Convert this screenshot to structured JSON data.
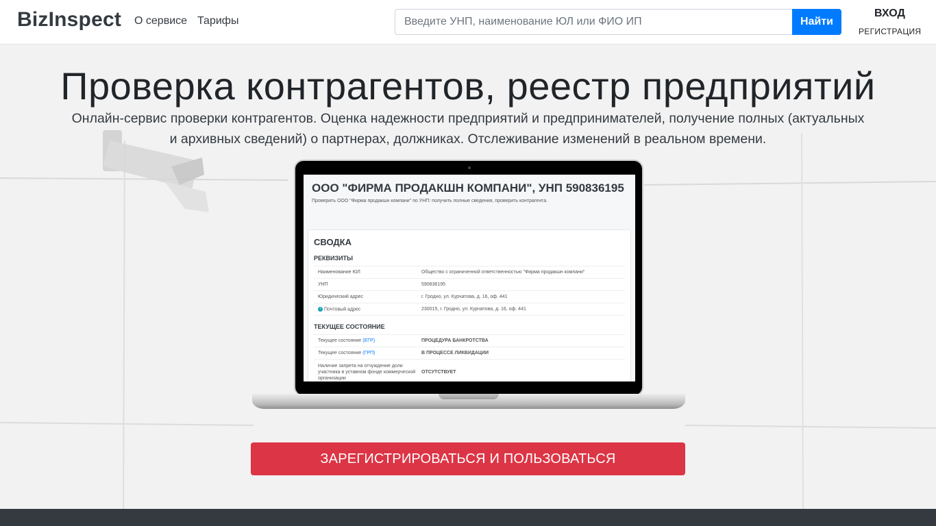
{
  "nav": {
    "brand": "BizInspect",
    "about": "О сервисе",
    "tariffs": "Тарифы",
    "search_placeholder": "Введите УНП, наименование ЮЛ или ФИО ИП",
    "search_button": "Найти",
    "login": "ВХОД",
    "register": "РЕГИСТРАЦИЯ"
  },
  "hero": {
    "title": "Проверка контрагентов, реестр предприятий",
    "lead": "Онлайн-сервис проверки контрагентов. Оценка надежности предприятий и предпринимателей, получение полных (актуальных и архивных сведений) о партнерах, должниках. Отслеживание изменений в реальном времени."
  },
  "screen": {
    "title": "ООО \"ФИРМА ПРОДАКШН КОМПАНИ\", УНП 590836195",
    "subtitle": "Проверить ООО \"Фирма продакшн компани\" по УНП: получить полные сведения, проверить контрагента.",
    "summary_heading": "СВОДКА",
    "requisites_heading": "РЕКВИЗИТЫ",
    "requisites": [
      {
        "key": "Наименование ЮЛ",
        "value": "Общество с ограниченной ответственностью \"Фирма продакшн компани\""
      },
      {
        "key": "УНП",
        "value": "590836195"
      },
      {
        "key": "Юридический адрес",
        "value": "г. Гродно, ул. Курчатова, д. 16, оф. 441"
      },
      {
        "key": "Почтовый адрес",
        "value": "230015, г. Гродно, ул. Курчатова, д. 16, оф. 441"
      }
    ],
    "status_heading": "ТЕКУЩЕЕ СОСТОЯНИЕ",
    "status_rows": [
      {
        "key": "Текущее состояние",
        "link": "(ЕГР)",
        "value": "ПРОЦЕДУРА БАНКРОТСТВА"
      },
      {
        "key": "Текущее состояние",
        "link": "(ГРП)",
        "value": "В ПРОЦЕССЕ ЛИКВИДАЦИИ"
      },
      {
        "key": "Наличие запрета на отчуждение доли участника в уставном фонде коммерческой организации",
        "link": "",
        "value": "ОТСУТСТВУЕТ"
      }
    ]
  },
  "cta": {
    "label": "ЗАРЕГИСТРИРОВАТЬСЯ И ПОЛЬЗОВАТЬСЯ"
  },
  "colors": {
    "primary": "#007bff",
    "danger": "#dc3545",
    "success": "#28a745",
    "dark": "#343a40"
  }
}
